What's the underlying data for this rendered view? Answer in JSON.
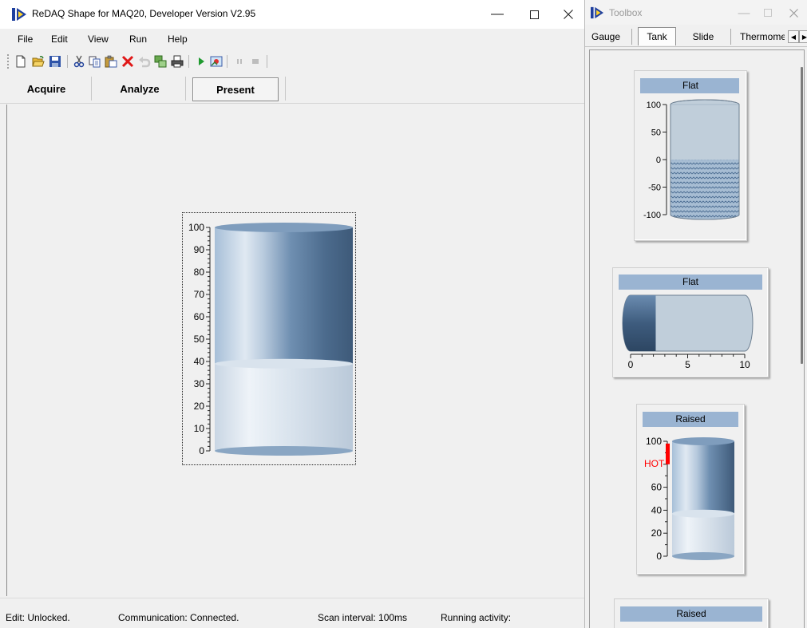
{
  "window": {
    "title": "ReDAQ Shape for MAQ20, Developer Version V2.95",
    "icon": "redaq-logo-icon",
    "controls": [
      "minimize-icon",
      "maximize-icon",
      "close-icon"
    ]
  },
  "menu": {
    "items": [
      "File",
      "Edit",
      "View",
      "Run",
      "Help"
    ]
  },
  "toolbar": {
    "icons": [
      "new-icon",
      "open-icon",
      "save-icon",
      "cut-icon",
      "copy-icon",
      "paste-icon",
      "delete-icon",
      "undo-icon",
      "bring-to-front-icon",
      "print-icon",
      "run-icon",
      "snapshot-icon",
      "pause-icon",
      "stop-icon"
    ]
  },
  "modes": {
    "tabs": [
      "Acquire",
      "Analyze",
      "Present"
    ],
    "active": "Present"
  },
  "canvas": {
    "tank_widget": {
      "type": "cylinder tank",
      "scale": {
        "min": 0,
        "max": 100,
        "major_step": 10
      },
      "tick_labels": [
        "100",
        "90",
        "80",
        "70",
        "60",
        "50",
        "40",
        "30",
        "20",
        "10",
        "0"
      ],
      "fill_level": 0.39,
      "fill_color": "#dbe4ee",
      "empty_color": "#5a7fa5",
      "selected": true
    }
  },
  "status": {
    "edit": "Edit: Unlocked.",
    "communication": "Communication: Connected.",
    "scan_interval": "Scan interval: 100ms",
    "activity": "Running activity:"
  },
  "toolbox": {
    "title": "Toolbox",
    "tabs": [
      "Gauge",
      "Tank",
      "Slide",
      "Thermome"
    ],
    "active_tab": "Tank",
    "tab_scroll_icons": [
      "scroll-left-icon",
      "scroll-right-icon"
    ],
    "items": [
      {
        "label": "Flat",
        "kind": "vertical flat tank",
        "tick_labels": [
          "100",
          "50",
          "0",
          "-50",
          "-100"
        ],
        "scale": {
          "min": -100,
          "max": 100
        },
        "fill_level": 0.5,
        "fill_style": "hatched"
      },
      {
        "label": "Flat",
        "kind": "horizontal flat tank",
        "tick_labels": [
          "0",
          "5",
          "10"
        ],
        "scale": {
          "min": 0,
          "max": 10
        },
        "fill_level": 2.2
      },
      {
        "label": "Raised",
        "kind": "raised cylinder tank",
        "tick_labels": [
          "100",
          "60",
          "40",
          "20",
          "0"
        ],
        "alarm_label": "HOT",
        "alarm_color": "#ff0000",
        "scale": {
          "min": 0,
          "max": 100
        },
        "fill_level": 0.37
      },
      {
        "label": "Raised",
        "kind": "raised tank"
      }
    ]
  }
}
